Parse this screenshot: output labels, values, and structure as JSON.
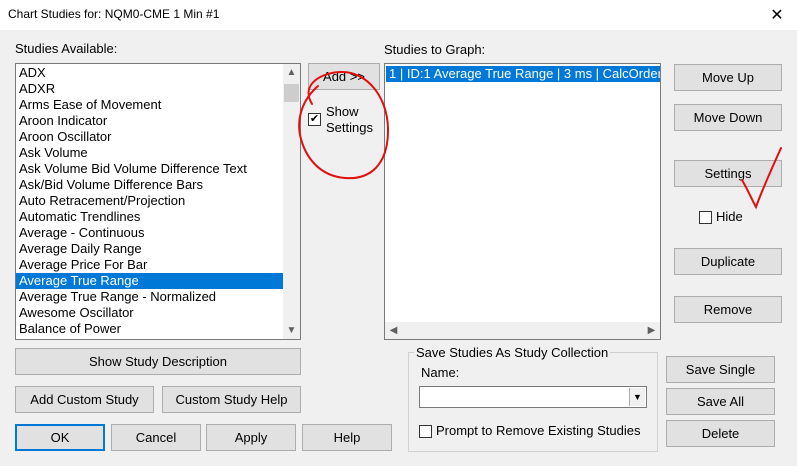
{
  "window": {
    "title": "Chart Studies for: NQM0-CME  1 Min  #1",
    "close_glyph": "✕"
  },
  "studies_available": {
    "label": "Studies Available:",
    "items": [
      "ADX",
      "ADXR",
      "Arms Ease of Movement",
      "Aroon Indicator",
      "Aroon Oscillator",
      "Ask Volume",
      "Ask Volume Bid Volume Difference Text",
      "Ask/Bid Volume Difference Bars",
      "Auto Retracement/Projection",
      "Automatic Trendlines",
      "Average - Continuous",
      "Average Daily Range",
      "Average Price For Bar",
      "Average True Range",
      "Average True Range - Normalized",
      "Awesome Oscillator",
      "Balance of Power",
      "Band/Channel"
    ],
    "selected_index": 13
  },
  "add_button": {
    "label": "Add >>"
  },
  "show_settings": {
    "label_line1": "Show",
    "label_line2": "Settings",
    "checked": true
  },
  "studies_to_graph": {
    "label": "Studies to Graph:",
    "items": [
      "1 | ID:1  Average True Range | 3 ms | CalcOrder"
    ]
  },
  "right_buttons": {
    "move_up": "Move Up",
    "move_down": "Move Down",
    "settings": "Settings",
    "hide": "Hide",
    "duplicate": "Duplicate",
    "remove": "Remove"
  },
  "bottom_left": {
    "show_description": "Show Study Description",
    "add_custom": "Add Custom Study",
    "custom_help": "Custom Study Help"
  },
  "collection": {
    "group_label": "Save Studies As Study Collection",
    "name_label": "Name:",
    "name_value": "",
    "prompt_label": "Prompt to Remove Existing Studies",
    "save_single": "Save Single",
    "save_all": "Save All",
    "delete": "Delete"
  },
  "footer": {
    "ok": "OK",
    "cancel": "Cancel",
    "apply": "Apply",
    "help": "Help"
  },
  "colors": {
    "selection": "#0078d7",
    "annotation": "#e01010"
  }
}
